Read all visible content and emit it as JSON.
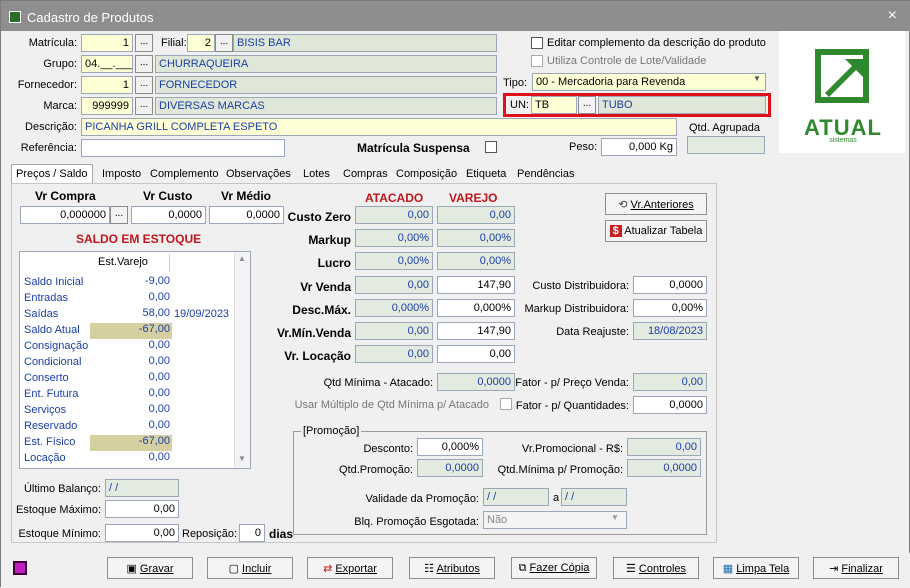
{
  "window": {
    "title": "Cadastro de Produtos",
    "close": "×"
  },
  "header": {
    "matricula_label": "Matrícula:",
    "matricula_value": "1",
    "filial_label": "Filial:",
    "filial_value": "2",
    "filial_name": "BISIS BAR",
    "grupo_label": "Grupo:",
    "grupo_value": "04.__.___",
    "grupo_name": "CHURRAQUEIRA",
    "fornecedor_label": "Fornecedor:",
    "fornecedor_value": "1",
    "fornecedor_name": "FORNECEDOR",
    "marca_label": "Marca:",
    "marca_value": "999999",
    "marca_name": "DIVERSAS MARCAS",
    "descricao_label": "Descrição:",
    "descricao_value": "PICANHA GRILL COMPLETA ESPETO",
    "referencia_label": "Referência:",
    "referencia_value": "",
    "matricula_suspensa_label": "Matrícula Suspensa",
    "peso_label": "Peso:",
    "peso_value": "0,000 Kg",
    "editar_label": "Editar complemento da descrição do produto",
    "lote_label": "Utiliza Controle de Lote/Validade",
    "tipo_label": "Tipo:",
    "tipo_value": "00 - Mercadoria para Revenda",
    "un_label": "UN:",
    "un_value": "TB",
    "un_name": "TUBO",
    "qtd_agrupada_label": "Qtd. Agrupada",
    "dots": "..."
  },
  "logo": {
    "text": "ATUAL",
    "sub": "sistemas"
  },
  "tabs": [
    "Preços / Saldo",
    "Imposto",
    "Complemento",
    "Observações",
    "Lotes",
    "Compras",
    "Composição",
    "Etiqueta",
    "Pendências"
  ],
  "precos": {
    "vr_compra_label": "Vr Compra",
    "vr_compra": "0,000000",
    "vr_custo_label": "Vr Custo",
    "vr_custo": "0,0000",
    "vr_medio_label": "Vr Médio",
    "vr_medio": "0,0000",
    "atacado": "ATACADO",
    "varejo": "VAREJO",
    "rows": [
      {
        "label": "Custo Zero",
        "atacado": "0,00",
        "varejo": "0,00"
      },
      {
        "label": "Markup",
        "atacado": "0,00%",
        "varejo": "0,00%"
      },
      {
        "label": "Lucro",
        "atacado": "0,00%",
        "varejo": "0,00%"
      },
      {
        "label": "Vr Venda",
        "atacado": "0,00",
        "varejo": "147,90"
      },
      {
        "label": "Desc.Máx.",
        "atacado": "0,000%",
        "varejo": "0,000%"
      },
      {
        "label": "Vr.Mín.Venda",
        "atacado": "0,00",
        "varejo": "147,90"
      },
      {
        "label": "Vr. Locação",
        "atacado": "0,00",
        "varejo": "0,00"
      }
    ],
    "vr_anteriores": "Vr.Anteriores",
    "atualizar_tabela": "Atualizar Tabela",
    "custo_distribuidora_label": "Custo Distribuidora:",
    "custo_distribuidora": "0,0000",
    "markup_distribuidora_label": "Markup Distribuidora:",
    "markup_distribuidora": "0,00%",
    "data_reajuste_label": "Data Reajuste:",
    "data_reajuste": "18/08/2023",
    "qtd_minima_label": "Qtd Mínima - Atacado:",
    "qtd_minima": "0,0000",
    "fator_preco_label": "Fator - p/ Preço Venda:",
    "fator_preco": "0,00",
    "usar_multiplo_label": "Usar Múltiplo de Qtd Mínima p/ Atacado",
    "fator_qtd_label": "Fator - p/ Quantidades:",
    "fator_qtd": "0,0000"
  },
  "saldo": {
    "title": "SALDO EM ESTOQUE",
    "col_header": "Est.Varejo",
    "rows": [
      {
        "label": "Saldo Inicial",
        "value": "-9,00",
        "date": ""
      },
      {
        "label": "Entradas",
        "value": "0,00",
        "date": ""
      },
      {
        "label": "Saídas",
        "value": "58,00",
        "date": "19/09/2023"
      },
      {
        "label": "Saldo Atual",
        "value": "-67,00",
        "date": ""
      },
      {
        "label": "Consignação",
        "value": "0,00",
        "date": ""
      },
      {
        "label": "Condicional",
        "value": "0,00",
        "date": ""
      },
      {
        "label": "Conserto",
        "value": "0,00",
        "date": ""
      },
      {
        "label": "Ent. Futura",
        "value": "0,00",
        "date": ""
      },
      {
        "label": "Serviços",
        "value": "0,00",
        "date": ""
      },
      {
        "label": "Reservado",
        "value": "0,00",
        "date": ""
      },
      {
        "label": "Est. Físico",
        "value": "-67,00",
        "date": ""
      },
      {
        "label": "Locação",
        "value": "0,00",
        "date": ""
      }
    ],
    "ultimo_balanco_label": "Último Balanço:",
    "ultimo_balanco": " /  /",
    "estoque_maximo_label": "Estoque Máximo:",
    "estoque_maximo": "0,00",
    "estoque_minimo_label": "Estoque Mínimo:",
    "estoque_minimo": "0,00",
    "reposicao_label": "Reposição:",
    "reposicao": "0",
    "dias": "dias"
  },
  "promocao": {
    "title": "[Promoção]",
    "desconto_label": "Desconto:",
    "desconto": "0,000%",
    "vr_promocional_label": "Vr.Promocional - R$:",
    "vr_promocional": "0,00",
    "qtd_promocao_label": "Qtd.Promoção:",
    "qtd_promocao": "0,0000",
    "qtd_minima_promo_label": "Qtd.Mínima p/ Promoção:",
    "qtd_minima_promo": "0,0000",
    "validade_label": "Validade da Promoção:",
    "validade_de": " /  /",
    "a_label": "a",
    "validade_ate": " /  /",
    "blq_label": "Blq. Promoção Esgotada:",
    "blq_value": "Não"
  },
  "toolbar": {
    "gravar": "Gravar",
    "incluir": "Incluir",
    "exportar": "Exportar",
    "atributos": "Atributos",
    "fazer_copia": "Fazer Cópia",
    "controles": "Controles",
    "limpa_tela": "Limpa Tela",
    "finalizar": "Finalizar"
  },
  "colors": {
    "highlight_box": "#e0101a",
    "blue_text": "#1a3ea8",
    "red_header": "#c0161d",
    "logo_green": "#2f8a2f"
  }
}
